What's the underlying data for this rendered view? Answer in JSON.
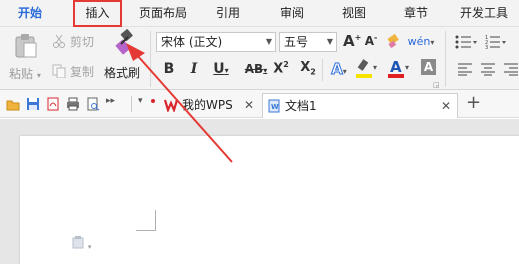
{
  "tabs": [
    {
      "label": "开始",
      "state": "active"
    },
    {
      "label": "插入",
      "state": "highlighted"
    },
    {
      "label": "页面布局"
    },
    {
      "label": "引用"
    },
    {
      "label": "审阅"
    },
    {
      "label": "视图"
    },
    {
      "label": "章节"
    },
    {
      "label": "开发工具"
    }
  ],
  "clipboard": {
    "paste_label": "粘贴",
    "cut_label": "剪切",
    "copy_label": "复制",
    "format_painter_label": "格式刷"
  },
  "font": {
    "family_value": "宋体 (正文)",
    "size_value": "五号"
  },
  "doc_tabs": [
    {
      "label": "我的WPS",
      "icon": "wps-logo-icon"
    },
    {
      "label": "文档1",
      "icon": "document-icon",
      "active": true
    }
  ],
  "colors": {
    "accent": "#2a6ad9",
    "highlight_border": "#e53935",
    "annotation_arrow": "#e53935",
    "wps_red": "#d8262c",
    "font_color_bar": "#e02020",
    "highlight_bar": "#f7e300"
  },
  "annotation": {
    "type": "red-arrow",
    "points_to": "format-painter-button",
    "highlighted_tab": "插入"
  }
}
